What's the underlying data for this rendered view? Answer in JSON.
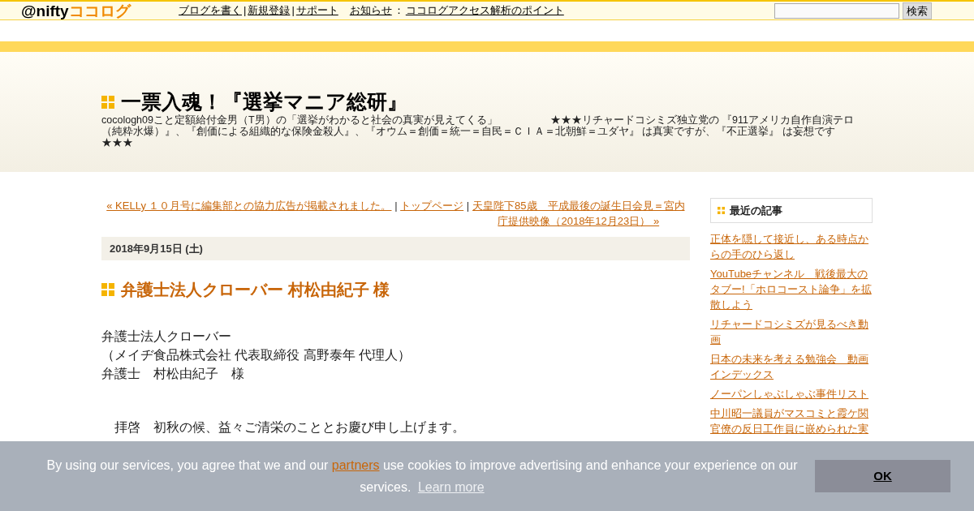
{
  "topbar": {
    "logo": {
      "brand": "@nifty",
      "product": "ココログ"
    },
    "links": [
      {
        "label": "ブログを書く",
        "separator": "|"
      },
      {
        "label": "新規登録",
        "separator": "|"
      },
      {
        "label": "サポート"
      }
    ],
    "notice": {
      "label": "お知らせ",
      "colon": "：",
      "link": "ココログアクセス解析のポイント"
    },
    "search": {
      "button": "検索"
    }
  },
  "header": {
    "title": "一票入魂！『選挙マニア総研』",
    "description": "cocologh09こと定額給付金男（T男）の「選挙がわかると社会の真実が見えてくる」　　　　　★★★リチャードコシミズ独立党の 『911アメリカ自作自演テロ（純粋水爆）』、『創価による組織的な保険金殺人』、『オウム＝創価＝統一＝自民＝ＣＩＡ＝北朝鮮＝ユダヤ』 は真実ですが、『不正選挙』 は妄想です★★★"
  },
  "nav": {
    "prev": "« KELLy １０月号に編集部との協力広告が掲載されました。",
    "separator1": "|",
    "top": "トップページ",
    "separator2": "|",
    "next": "天皇陛下85歳　平成最後の誕生日会見＝宮内庁提供映像（2018年12月23日） »"
  },
  "post": {
    "date": "2018年9月15日 (土)",
    "title": "弁護士法人クローバー 村松由紀子 様",
    "address_lines": [
      "弁護士法人クローバー",
      "（メイヂ食品株式会社 代表取締役 高野泰年 代理人）",
      "弁護士　村松由紀子　様"
    ],
    "greeting": "　拝啓　初秋の候、益々ご清栄のこととお慶び申し上げます。"
  },
  "sidebar": {
    "heading": "最近の記事",
    "items": [
      "正体を隠して接近し、ある時点からの手のひら返し",
      "YouTubeチャンネル　戦後最大のタブー!「ホロコースト論争」を拡散しよう",
      "リチャードコシミズが見るべき動画",
      "日本の未来を考える勉強会　動画インデックス",
      "ノーパンしゃぶしゃぶ事件リスト",
      "中川昭一議員がマスコミと霞ケ関官僚の反日工作員に嵌められた実"
    ]
  },
  "cookie_banner": {
    "text_before": "By using our services, you agree that we and our",
    "link": "partners",
    "text_after": "use cookies to improve advertising and enhance your experience on our services.",
    "learn_more": "Learn more",
    "button": "OK"
  }
}
